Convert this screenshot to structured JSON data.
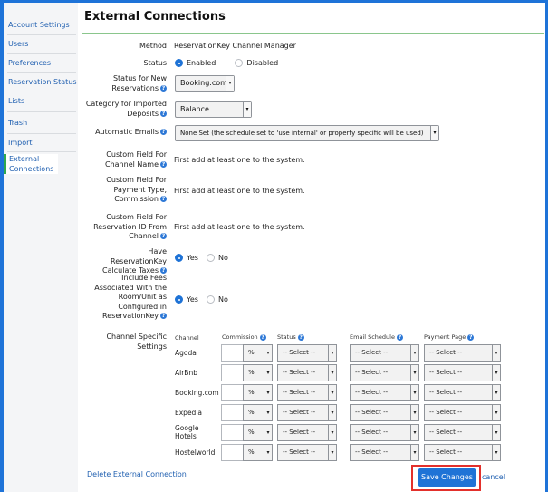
{
  "sidebar": {
    "items": [
      {
        "label": "Account Settings"
      },
      {
        "label": "Users"
      },
      {
        "label": "Preferences"
      },
      {
        "label": "Reservation Status"
      },
      {
        "label": "Lists"
      },
      {
        "label": "Trash"
      },
      {
        "label": "Import"
      },
      {
        "label": "External Connections"
      }
    ],
    "active": "External Connections"
  },
  "page": {
    "title": "External Connections"
  },
  "form": {
    "method": {
      "label": "Method",
      "value": "ReservationKey Channel Manager"
    },
    "status": {
      "label": "Status",
      "options": [
        "Enabled",
        "Disabled"
      ],
      "selected": "Enabled"
    },
    "status_new": {
      "label": "Status for New Reservations",
      "value": "Booking.com"
    },
    "category": {
      "label": "Category for Imported Deposits",
      "value": "Balance"
    },
    "auto_emails": {
      "label": "Automatic Emails",
      "value": "None Set (the schedule set to 'use internal' or property specific will be used)"
    },
    "cf_channel_name": {
      "label": "Custom Field For Channel Name",
      "value": "First add at least one to the system."
    },
    "cf_payment": {
      "label": "Custom Field For Payment Type, Commission",
      "value": "First add at least one to the system."
    },
    "cf_resid": {
      "label": "Custom Field For Reservation ID From Channel",
      "value": "First add at least one to the system."
    },
    "calc_taxes": {
      "label": "Have ReservationKey Calculate Taxes",
      "options": [
        "Yes",
        "No"
      ],
      "selected": "Yes"
    },
    "include_fees": {
      "label": "Include Fees Associated With the Room/Unit as Configured in ReservationKey",
      "options": [
        "Yes",
        "No"
      ],
      "selected": "Yes"
    },
    "channel_settings_label": "Channel Specific Settings"
  },
  "channel_table": {
    "headers": {
      "channel": "Channel",
      "commission": "Commission",
      "status": "Status",
      "email": "Email Schedule",
      "payment": "Payment Page"
    },
    "pct_symbol": "%",
    "select_placeholder": "-- Select --",
    "rows": [
      {
        "name": "Agoda"
      },
      {
        "name": "AirBnb"
      },
      {
        "name": "Booking.com"
      },
      {
        "name": "Expedia"
      },
      {
        "name": "Google Hotels"
      },
      {
        "name": "Hostelworld"
      }
    ]
  },
  "footer": {
    "delete_link": "Delete External Connection",
    "save_label": "Save Changes",
    "cancel_label": "cancel"
  },
  "colors": {
    "accent": "#1f73d6",
    "link": "#1f5fb0",
    "highlight": "#e3302b",
    "active_bar": "#2fa84f"
  }
}
